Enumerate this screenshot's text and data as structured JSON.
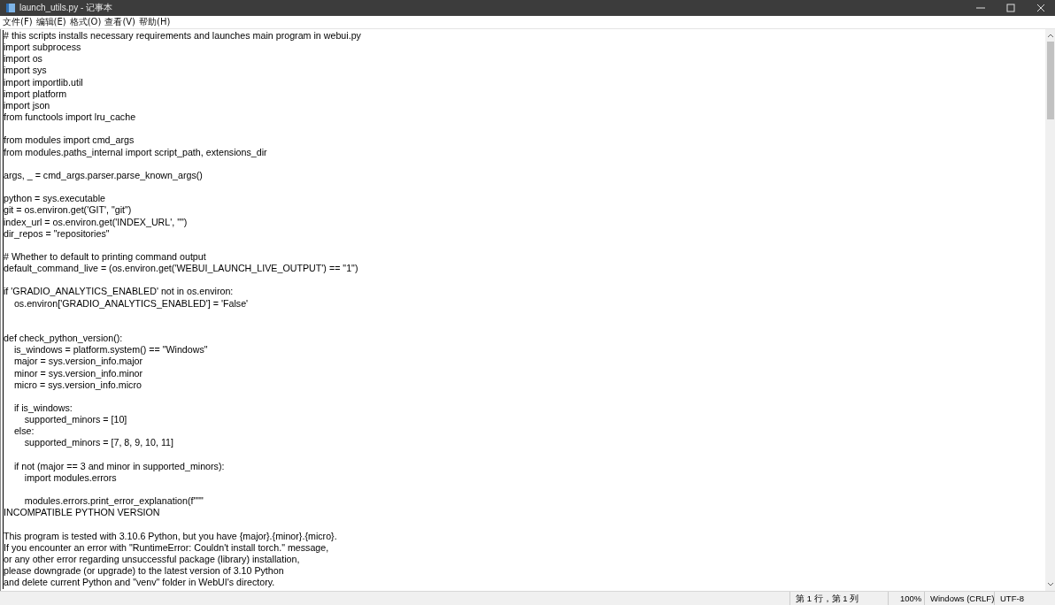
{
  "window": {
    "title": "launch_utils.py - 记事本"
  },
  "menu": [
    "文件(F)",
    "编辑(E)",
    "格式(O)",
    "查看(V)",
    "帮助(H)"
  ],
  "editor": {
    "text": "# this scripts installs necessary requirements and launches main program in webui.py\nimport subprocess\nimport os\nimport sys\nimport importlib.util\nimport platform\nimport json\nfrom functools import lru_cache\n\nfrom modules import cmd_args\nfrom modules.paths_internal import script_path, extensions_dir\n\nargs, _ = cmd_args.parser.parse_known_args()\n\npython = sys.executable\ngit = os.environ.get('GIT', \"git\")\nindex_url = os.environ.get('INDEX_URL', \"\")\ndir_repos = \"repositories\"\n\n# Whether to default to printing command output\ndefault_command_live = (os.environ.get('WEBUI_LAUNCH_LIVE_OUTPUT') == \"1\")\n\nif 'GRADIO_ANALYTICS_ENABLED' not in os.environ:\n    os.environ['GRADIO_ANALYTICS_ENABLED'] = 'False'\n\n\ndef check_python_version():\n    is_windows = platform.system() == \"Windows\"\n    major = sys.version_info.major\n    minor = sys.version_info.minor\n    micro = sys.version_info.micro\n\n    if is_windows:\n        supported_minors = [10]\n    else:\n        supported_minors = [7, 8, 9, 10, 11]\n\n    if not (major == 3 and minor in supported_minors):\n        import modules.errors\n\n        modules.errors.print_error_explanation(f\"\"\"\nINCOMPATIBLE PYTHON VERSION\n\nThis program is tested with 3.10.6 Python, but you have {major}.{minor}.{micro}.\nIf you encounter an error with \"RuntimeError: Couldn't install torch.\" message,\nor any other error regarding unsuccessful package (library) installation,\nplease downgrade (or upgrade) to the latest version of 3.10 Python\nand delete current Python and \"venv\" folder in WebUI's directory."
  },
  "status_bar": [
    "第 1 行，第 1 列",
    "100%",
    "Windows (CRLF)",
    "UTF-8"
  ]
}
